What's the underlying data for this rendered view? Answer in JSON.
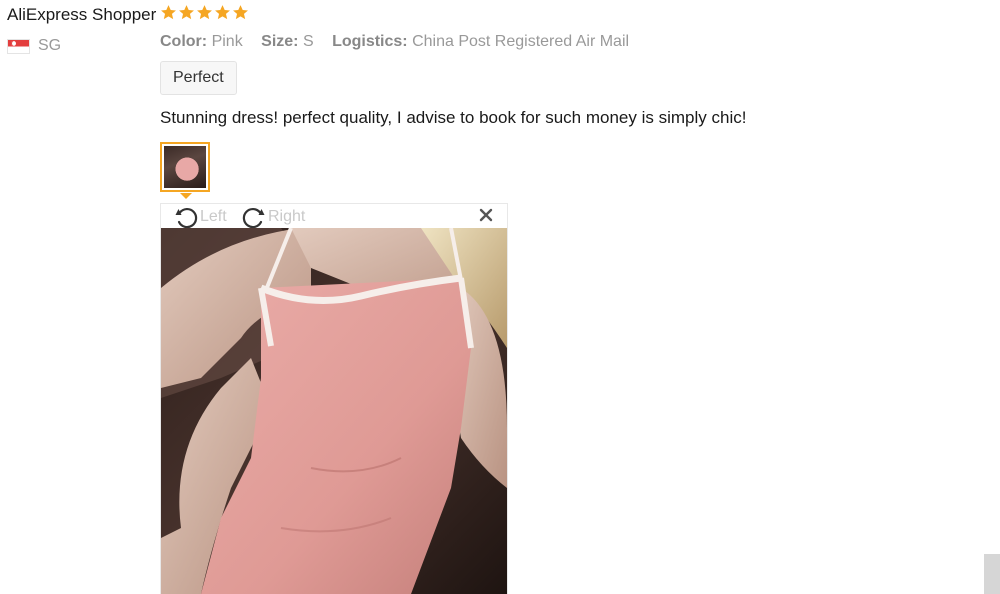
{
  "review": {
    "user_name": "AliExpress Shopper",
    "rating": 5,
    "country_code": "SG",
    "attributes": [
      {
        "key": "Color:",
        "value": "Pink"
      },
      {
        "key": "Size:",
        "value": "S"
      },
      {
        "key": "Logistics:",
        "value": "China Post Registered Air Mail"
      }
    ],
    "tag": "Perfect",
    "text": "Stunning dress! perfect quality, I advise to book for such money is simply chic!"
  },
  "viewer": {
    "rotate_left_label": "Left",
    "rotate_right_label": "Right"
  },
  "colors": {
    "star": "#f5a623",
    "thumb_border": "#f5a623",
    "muted_text": "#999999"
  },
  "icons": {
    "rating": "star-icon",
    "rotate_left": "rotate-left-icon",
    "rotate_right": "rotate-right-icon",
    "close": "close-icon",
    "flag": "singapore-flag-icon"
  }
}
